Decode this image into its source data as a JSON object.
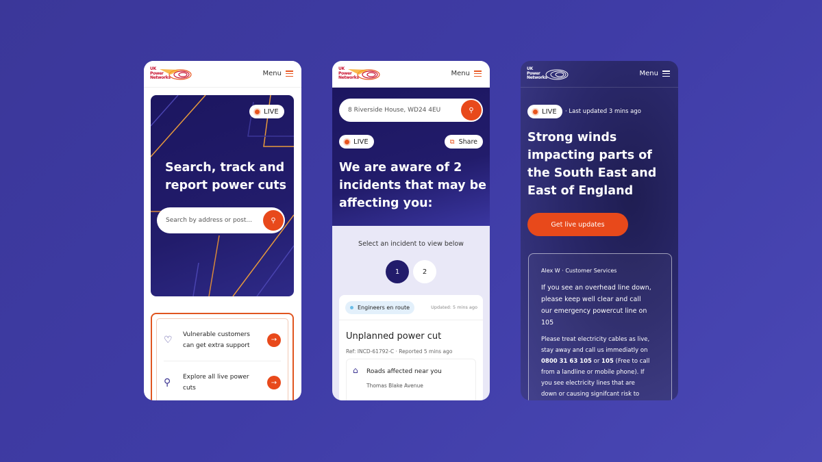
{
  "brand": {
    "logo_text": "UK Power Networks",
    "menu_label": "Menu",
    "accent": "#e8491b",
    "navy": "#221c6b"
  },
  "screen1": {
    "live_label": "LIVE",
    "title_lines": [
      "Search, track and",
      "report power cuts"
    ],
    "search_placeholder": "Search by address or post...",
    "links": [
      {
        "icon": "heart-hand-icon",
        "lines": [
          "Vulnerable customers",
          "can get extra support"
        ]
      },
      {
        "icon": "map-pin-icon",
        "lines": [
          "Explore all live power",
          "cuts"
        ]
      }
    ]
  },
  "screen2": {
    "search_value": "8 Riverside House, WD24 4EU",
    "live_label": "LIVE",
    "share_label": "Share",
    "title_lines": [
      "We are aware of 2",
      "incidents that may be",
      "affecting you:"
    ],
    "select_prompt": "Select an incident to view below",
    "incident_tabs": [
      "1",
      "2"
    ],
    "active_tab": "1",
    "card": {
      "status": "Engineers en route",
      "updated": "Updated: 5 mins ago",
      "title": "Unplanned power cut",
      "ref": "Ref: INCD-61792-C · Reported 5 mins ago",
      "roads_title": "Roads affected near you",
      "road": "Thomas Blake Avenue"
    }
  },
  "screen3": {
    "live_label": "LIVE",
    "last_updated": "· Last updated 3 mins ago",
    "title_lines": [
      "Strong winds",
      "impacting parts of",
      "the South East and",
      "East of England"
    ],
    "cta": "Get live updates",
    "author": "Alex W",
    "role": "Customer Services",
    "lead_lines": [
      "If you see an overhead line down,",
      "please keep well clear and call",
      "our emergency powercut line on",
      "105"
    ],
    "body_lines": [
      "Please treat electricity cables as live,",
      "stay away and call us immediatly on"
    ],
    "body_bold1": "0800 31 63 105",
    "body_or": " or ",
    "body_bold2": "105",
    "body_rest1": " (Free to call",
    "body_more": [
      "from a landline or mobile phone). If",
      "you see electricity lines that are",
      "down or causing signifcant risk to"
    ]
  }
}
